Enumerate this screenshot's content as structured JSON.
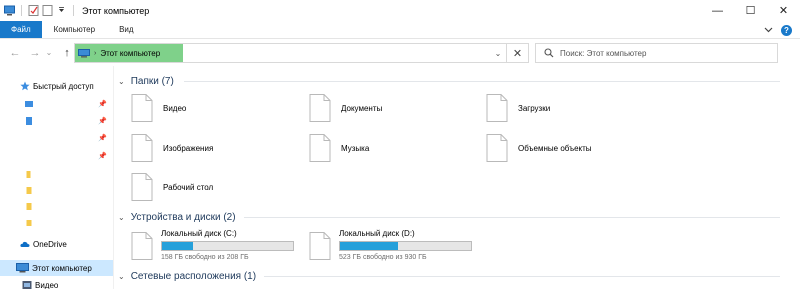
{
  "window": {
    "title": "Этот компьютер",
    "controls": {
      "minimize": "—",
      "maximize": "☐",
      "close": "✕"
    }
  },
  "ribbon": {
    "tabs": [
      "Файл",
      "Компьютер",
      "Вид"
    ],
    "expand_icon": "chevron-down-icon",
    "help": "?"
  },
  "nav": {
    "back": "←",
    "forward": "→",
    "recent": "⌄",
    "up": "↑",
    "address": {
      "chevron": "›",
      "location": "Этот компьютер",
      "dropdown": "⌄",
      "clear": "✕"
    },
    "search": {
      "placeholder": "Поиск: Этот компьютер"
    }
  },
  "sidebar": {
    "items": [
      {
        "label": "Быстрый доступ",
        "icon": "star-icon"
      },
      {
        "label": "OneDrive",
        "icon": "cloud-icon"
      },
      {
        "label": "Этот компьютер",
        "icon": "computer-icon",
        "selected": true
      },
      {
        "label": "Видео",
        "icon": "video-folder-icon"
      }
    ]
  },
  "groups": {
    "folders": {
      "header": "Папки (7)",
      "items": [
        "Видео",
        "Документы",
        "Загрузки",
        "Изображения",
        "Музыка",
        "Объемные объекты",
        "Рабочий стол"
      ]
    },
    "drives": {
      "header": "Устройства и диски (2)",
      "items": [
        {
          "name": "Локальный диск (C:)",
          "free": "158 ГБ свободно из 208 ГБ",
          "used_fraction": 0.24
        },
        {
          "name": "Локальный диск (D:)",
          "free": "523 ГБ свободно из 930 ГБ",
          "used_fraction": 0.44
        }
      ]
    },
    "network": {
      "header": "Сетевые расположения (1)"
    }
  },
  "colors": {
    "accent": "#1979ca",
    "address_highlight": "#7fd18a",
    "bar_fill": "#26a0da",
    "selected": "#cce8ff",
    "group_header": "#1e395b"
  }
}
